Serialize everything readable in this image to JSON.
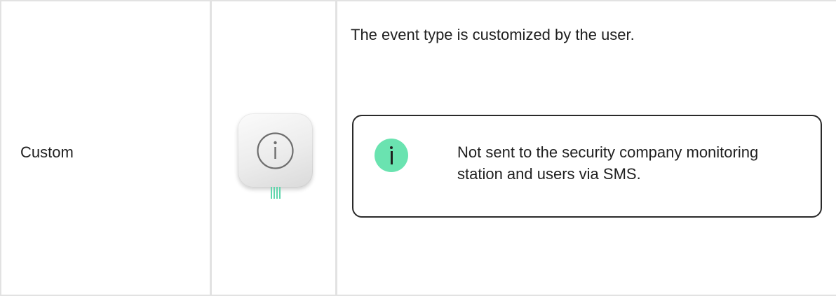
{
  "row": {
    "event_type": "Custom",
    "device_icon": "info-icon",
    "description": "The event type is customized by the user.",
    "note": {
      "icon": "info-icon",
      "text": "Not sent to the security company monitoring station and users via SMS."
    }
  },
  "colors": {
    "border": "#e2e2e2",
    "note_border": "#2a2a2a",
    "badge": "#6ae3b0",
    "wires": "#5fd6ac",
    "text": "#1f1f1f"
  }
}
